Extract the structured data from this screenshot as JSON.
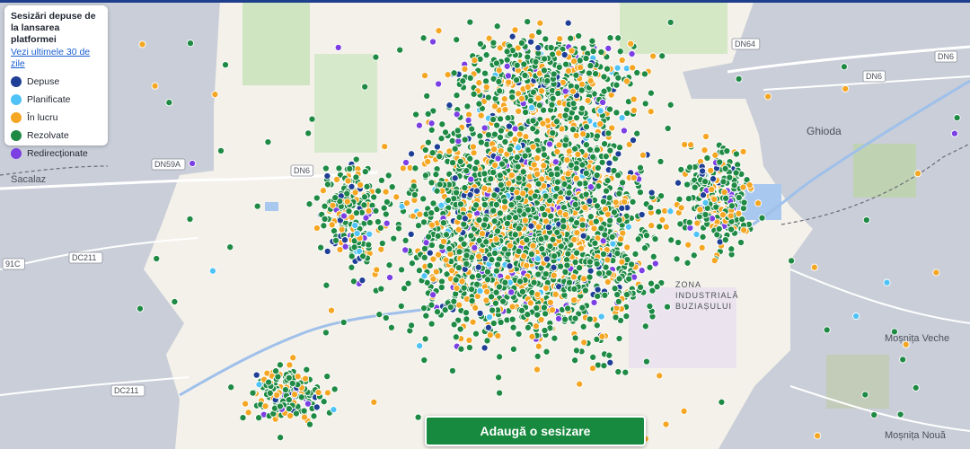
{
  "legend": {
    "title": "Sesizări depuse de la lansarea platformei",
    "link": "Vezi ultimele 30 de zile",
    "items": [
      {
        "label": "Depuse",
        "color": "#1f3f96"
      },
      {
        "label": "Planificate",
        "color": "#4fc3f7"
      },
      {
        "label": "În lucru",
        "color": "#f5a623"
      },
      {
        "label": "Rezolvate",
        "color": "#1e8a44"
      },
      {
        "label": "Redirecționate",
        "color": "#7b3fe4"
      }
    ]
  },
  "map": {
    "places": [
      {
        "name": "Ghioda",
        "kind": "town"
      },
      {
        "name": "Sacalaz",
        "kind": "town"
      },
      {
        "name": "Moșnița Veche",
        "kind": "town"
      },
      {
        "name": "Moșnița Nouă",
        "kind": "town"
      },
      {
        "name": "ZONA INDUSTRIALĂ BUZIAȘULUI",
        "kind": "district"
      }
    ],
    "roads": [
      "DN6",
      "DN6",
      "DN64",
      "DN59A",
      "DN6",
      "DC211",
      "DC211",
      "91C"
    ],
    "status_colors": {
      "depuse": "#1f3f96",
      "planificate": "#4fc3f7",
      "in_lucru": "#f5a623",
      "rezolvate": "#1e8a44",
      "redirectionate": "#7b3fe4"
    }
  },
  "actions": {
    "add_report": "Adaugă o sesizare"
  }
}
